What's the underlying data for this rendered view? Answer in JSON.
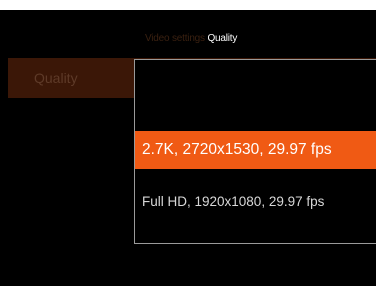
{
  "breadcrumb": {
    "parent": "Video settings",
    "current": "Quality"
  },
  "menu": {
    "row_label": "Quality"
  },
  "dropdown": {
    "options": [
      {
        "label": "2.7K, 2720x1530, 29.97 fps",
        "selected": true
      },
      {
        "label": "Full HD, 1920x1080, 29.97 fps",
        "selected": false
      }
    ]
  },
  "colors": {
    "accent": "#f05a14",
    "row_background": "#3b1707",
    "border": "#9a9a9a"
  }
}
